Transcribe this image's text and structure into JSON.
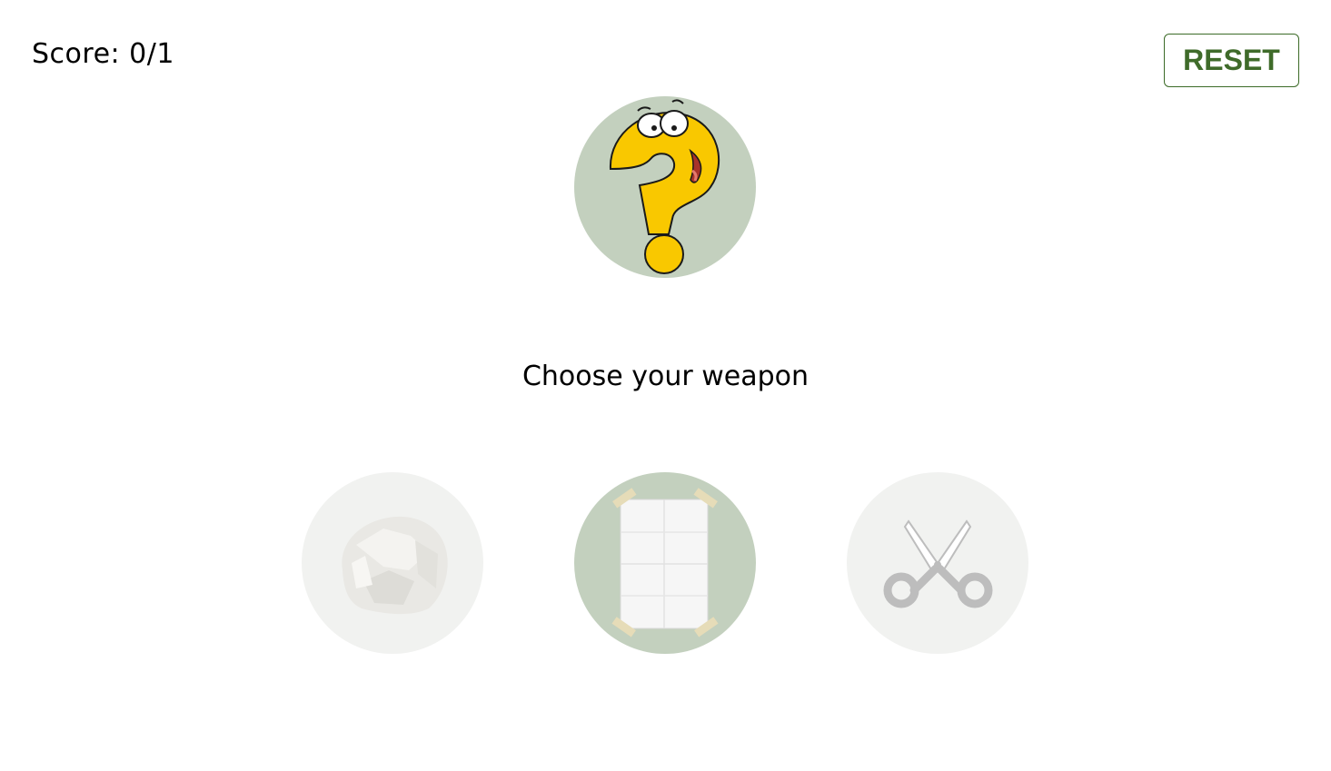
{
  "score": {
    "text": "Score: 0/1"
  },
  "controls": {
    "reset_label": "RESET"
  },
  "opponent": {
    "icon": "question-mark-character-icon",
    "state": "unknown"
  },
  "prompt": {
    "text": "Choose your weapon"
  },
  "weapons": [
    {
      "id": "rock",
      "icon": "rock-icon",
      "state": "dimmed"
    },
    {
      "id": "paper",
      "icon": "paper-icon",
      "state": "selected"
    },
    {
      "id": "scissors",
      "icon": "scissors-icon",
      "state": "dimmed"
    }
  ],
  "colors": {
    "reset_text": "#3f6b2a",
    "selected_circle": "#c3d0be",
    "unselected_circle": "#f1f2f0",
    "question_mark": "#f9c800"
  }
}
